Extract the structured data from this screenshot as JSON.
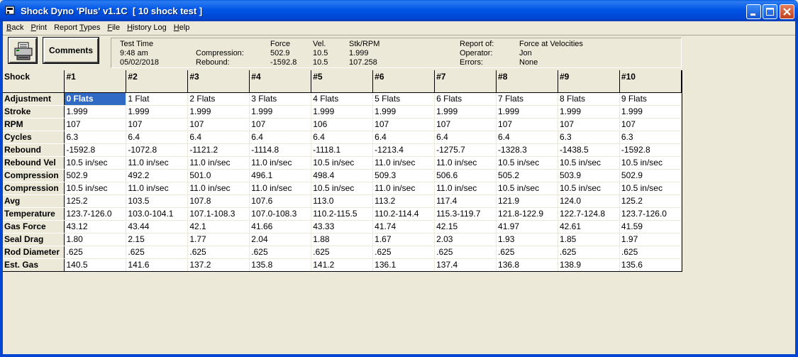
{
  "window": {
    "title": "Shock Dyno 'Plus' v1.1C  [ 10 shock test ]"
  },
  "menu": [
    {
      "before": "",
      "ul": "B",
      "after": "ack"
    },
    {
      "before": "",
      "ul": "P",
      "after": "rint"
    },
    {
      "before": "Report ",
      "ul": "T",
      "after": "ypes"
    },
    {
      "before": "",
      "ul": "F",
      "after": "ile"
    },
    {
      "before": "",
      "ul": "H",
      "after": "istory Log"
    },
    {
      "before": "",
      "ul": "H",
      "after": "elp"
    }
  ],
  "toolbar": {
    "print_icon": "printer-icon",
    "comments_label": "Comments"
  },
  "info": {
    "test_time_label": "Test Time",
    "time": "9:48 am",
    "date": "05/02/2018",
    "compression_label": "Compression:",
    "rebound_label": "Rebound:",
    "force_header": "Force",
    "vel_header": "Vel.",
    "stk_header": "Stk/RPM",
    "compression_force": "502.9",
    "compression_vel": "10.5",
    "compression_stk": "1.999",
    "rebound_force": "-1592.8",
    "rebound_vel": "10.5",
    "rebound_stk": "107.258",
    "report_of_label": "Report of:",
    "report_of_value": "Force at Velocities",
    "operator_label": "Operator:",
    "operator_value": "Jon",
    "errors_label": "Errors:",
    "errors_value": "None"
  },
  "grid": {
    "corner": "Shock",
    "columns": [
      "#1",
      "#2",
      "#3",
      "#4",
      "#5",
      "#6",
      "#7",
      "#8",
      "#9",
      "#10"
    ],
    "rows": [
      {
        "label": "Adjustment",
        "values": [
          "0 Flats",
          "1 Flat",
          "2 Flats",
          "3 Flats",
          "4 Flats",
          "5 Flats",
          "6 Flats",
          "7 Flats",
          "8 Flats",
          "9 Flats"
        ]
      },
      {
        "label": "Stroke",
        "values": [
          "1.999",
          "1.999",
          "1.999",
          "1.999",
          "1.999",
          "1.999",
          "1.999",
          "1.999",
          "1.999",
          "1.999"
        ]
      },
      {
        "label": "RPM",
        "values": [
          "107",
          "107",
          "107",
          "107",
          "106",
          "107",
          "107",
          "107",
          "107",
          "107"
        ]
      },
      {
        "label": "Cycles",
        "values": [
          "6.3",
          "6.4",
          "6.4",
          "6.4",
          "6.4",
          "6.4",
          "6.4",
          "6.4",
          "6.3",
          "6.3"
        ]
      },
      {
        "label": "Rebound",
        "values": [
          "-1592.8",
          "-1072.8",
          "-1121.2",
          "-1114.8",
          "-1118.1",
          "-1213.4",
          "-1275.7",
          "-1328.3",
          "-1438.5",
          "-1592.8"
        ]
      },
      {
        "label": "Rebound Vel",
        "values": [
          "10.5 in/sec",
          "11.0 in/sec",
          "11.0 in/sec",
          "11.0 in/sec",
          "10.5 in/sec",
          "11.0 in/sec",
          "11.0 in/sec",
          "10.5 in/sec",
          "10.5 in/sec",
          "10.5 in/sec"
        ]
      },
      {
        "label": "Compression",
        "values": [
          "502.9",
          "492.2",
          "501.0",
          "496.1",
          "498.4",
          "509.3",
          "506.6",
          "505.2",
          "503.9",
          "502.9"
        ]
      },
      {
        "label": "Compression",
        "values": [
          "10.5 in/sec",
          "11.0 in/sec",
          "11.0 in/sec",
          "11.0 in/sec",
          "10.5 in/sec",
          "11.0 in/sec",
          "11.0 in/sec",
          "10.5 in/sec",
          "10.5 in/sec",
          "10.5 in/sec"
        ]
      },
      {
        "label": "Avg",
        "values": [
          "125.2",
          "103.5",
          "107.8",
          "107.6",
          "113.0",
          "113.2",
          "117.4",
          "121.9",
          "124.0",
          "125.2"
        ]
      },
      {
        "label": "Temperature",
        "values": [
          "123.7-126.0",
          "103.0-104.1",
          "107.1-108.3",
          "107.0-108.3",
          "110.2-115.5",
          "110.2-114.4",
          "115.3-119.7",
          "121.8-122.9",
          "122.7-124.8",
          "123.7-126.0"
        ]
      },
      {
        "label": "Gas Force",
        "values": [
          "43.12",
          "43.44",
          "42.1",
          "41.66",
          "43.33",
          "41.74",
          "42.15",
          "41.97",
          "42.61",
          "41.59"
        ]
      },
      {
        "label": "Seal Drag",
        "values": [
          "1.80",
          "2.15",
          "1.77",
          "2.04",
          "1.88",
          "1.67",
          "2.03",
          "1.93",
          "1.85",
          "1.97"
        ]
      },
      {
        "label": "Rod Diameter",
        "values": [
          ".625",
          ".625",
          ".625",
          ".625",
          ".625",
          ".625",
          ".625",
          ".625",
          ".625",
          ".625"
        ]
      },
      {
        "label": "Est. Gas",
        "values": [
          "140.5",
          "141.6",
          "137.2",
          "135.8",
          "141.2",
          "136.1",
          "137.4",
          "136.8",
          "138.9",
          "135.6"
        ]
      }
    ],
    "selected_cell": "0 Flats"
  }
}
